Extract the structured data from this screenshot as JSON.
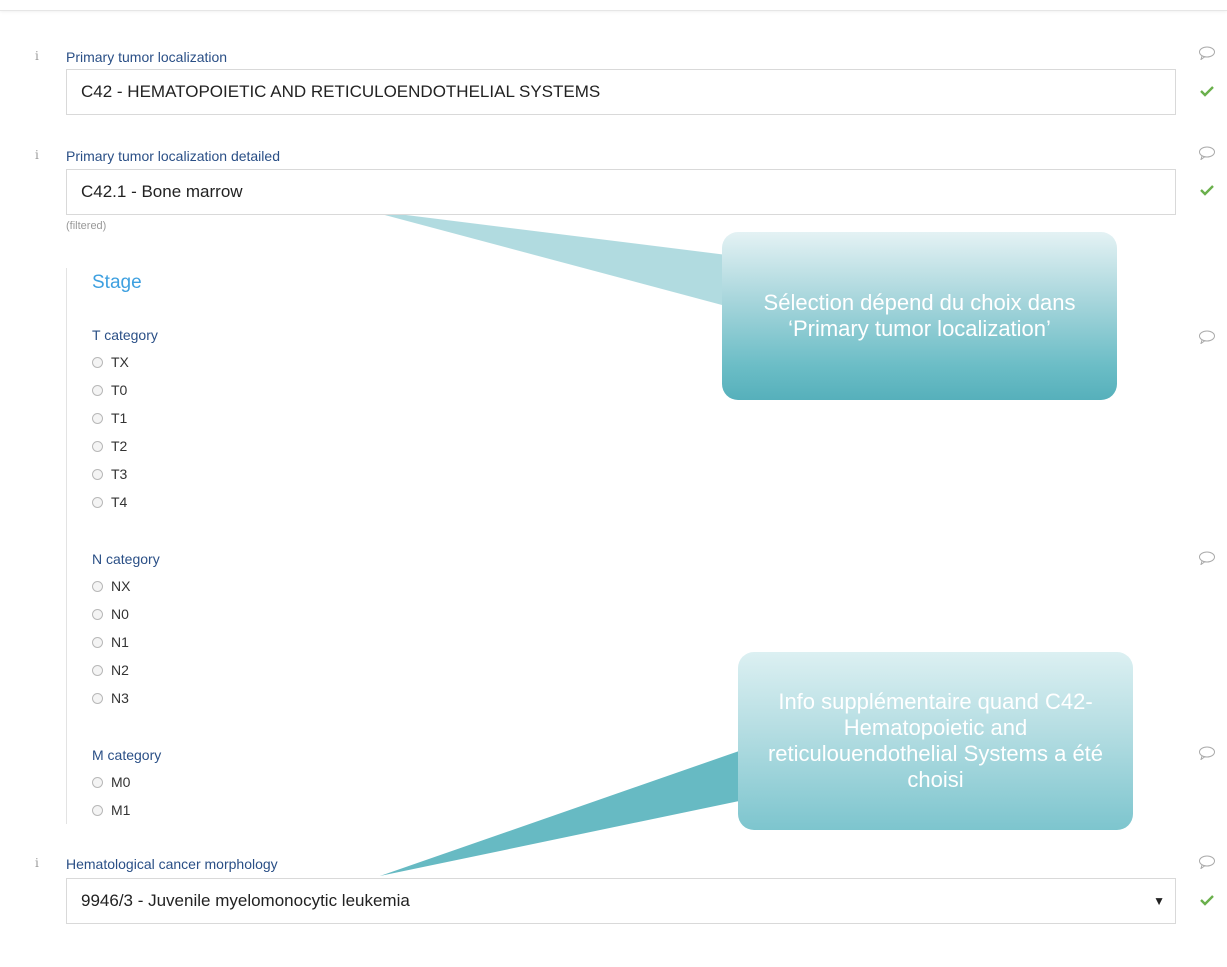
{
  "fields": {
    "primary_tumor_localization": {
      "label": "Primary tumor localization",
      "value": "C42 - HEMATOPOIETIC AND RETICULOENDOTHELIAL SYSTEMS"
    },
    "primary_tumor_localization_detailed": {
      "label": "Primary tumor localization detailed",
      "value": "C42.1 - Bone marrow",
      "hint": "(filtered)"
    },
    "hematological_cancer_morphology": {
      "label": "Hematological cancer morphology",
      "value": "9946/3 - Juvenile myelomonocytic leukemia",
      "caret": "▼"
    }
  },
  "stage": {
    "title": "Stage",
    "t_category": {
      "label": "T category",
      "options": [
        "TX",
        "T0",
        "T1",
        "T2",
        "T3",
        "T4"
      ]
    },
    "n_category": {
      "label": "N category",
      "options": [
        "NX",
        "N0",
        "N1",
        "N2",
        "N3"
      ]
    },
    "m_category": {
      "label": "M category",
      "options": [
        "M0",
        "M1"
      ]
    }
  },
  "callouts": {
    "selection_depends": "Sélection dépend du choix dans ‘Primary tumor localization’",
    "extra_info": "Info supplémentaire quand  C42- Hematopoietic and reticulouendothelial Systems a été choisi"
  },
  "icons": {
    "info": "i",
    "comment": "speech-bubble-icon",
    "check": "check-icon"
  },
  "colors": {
    "label_blue": "#2a4f86",
    "stage_blue": "#3ea0e0",
    "check_green": "#6ab04c",
    "callout_teal": "#56b0bb"
  }
}
